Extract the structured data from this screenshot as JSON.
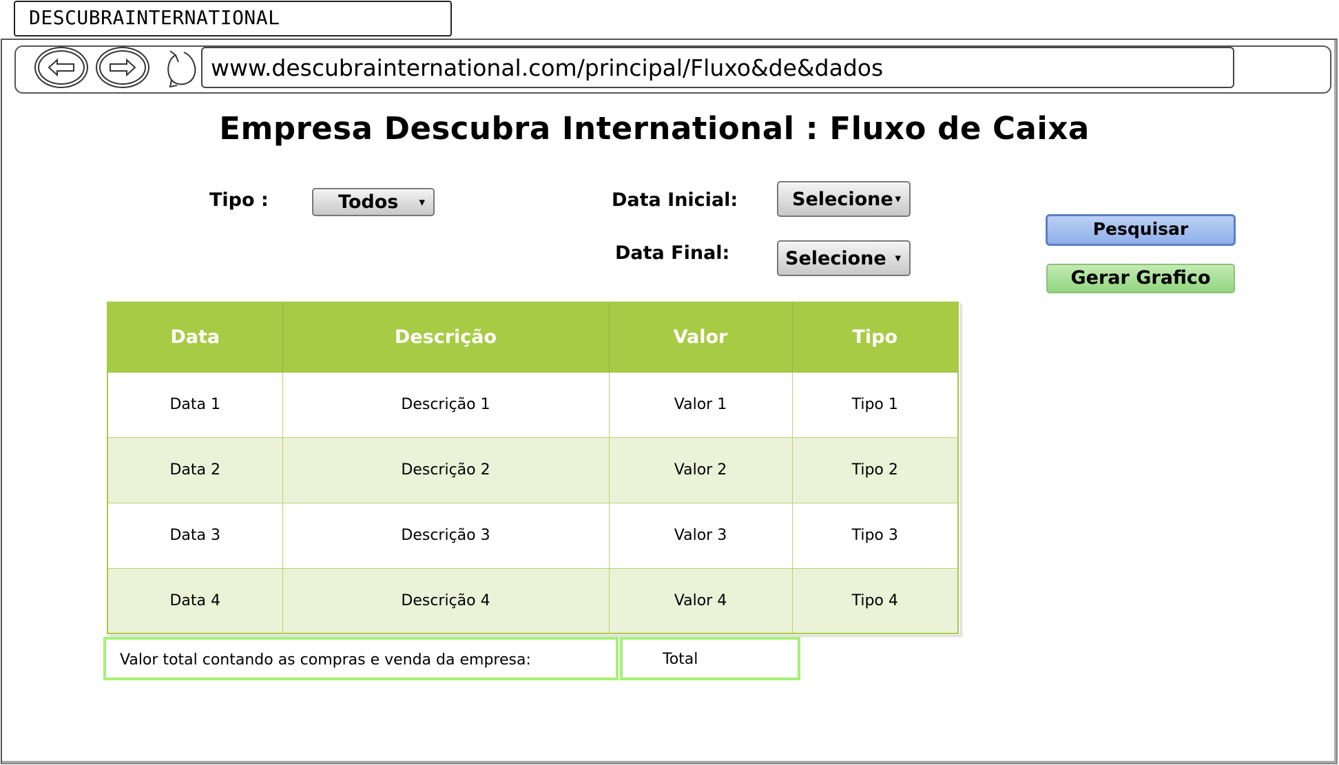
{
  "browser": {
    "tab_title": "DESCUBRAINTERNATIONAL",
    "url": "www.descubrainternational.com/principal/Fluxo&de&dados"
  },
  "page": {
    "title": "Empresa Descubra International : Fluxo de Caixa"
  },
  "filters": {
    "tipo_label": "Tipo :",
    "tipo_value": "Todos",
    "data_inicial_label": "Data Inicial:",
    "data_inicial_value": "Selecione",
    "data_final_label": "Data Final:",
    "data_final_value": "Selecione"
  },
  "actions": {
    "search_label": "Pesquisar",
    "chart_label": "Gerar Grafico"
  },
  "table": {
    "headers": [
      "Data",
      "Descrição",
      "Valor",
      "Tipo"
    ],
    "rows": [
      [
        "Data 1",
        "Descrição 1",
        "Valor 1",
        "Tipo 1"
      ],
      [
        "Data 2",
        "Descrição 2",
        "Valor 2",
        "Tipo 2"
      ],
      [
        "Data 3",
        "Descrição 3",
        "Valor 3",
        "Tipo 3"
      ],
      [
        "Data 4",
        "Descrição 4",
        "Valor 4",
        "Tipo 4"
      ]
    ]
  },
  "summary": {
    "label": "Valor total contando as compras e venda da empresa:",
    "value": "Total"
  },
  "colors": {
    "table_header": "#a8cb45",
    "table_alt_row": "#ebf2d7",
    "total_border": "#a4f276",
    "primary_button": "#8fb0ea",
    "green_button": "#93d57f"
  }
}
